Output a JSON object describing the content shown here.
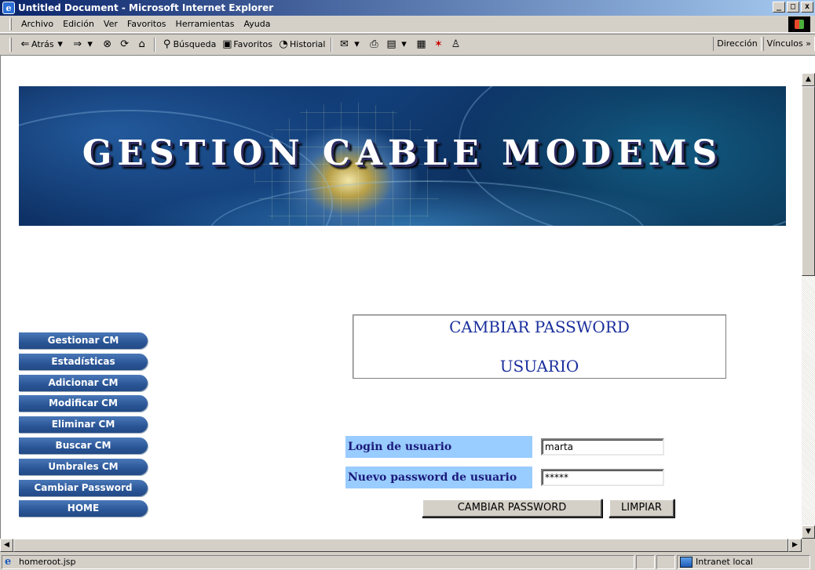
{
  "window": {
    "title": "Untitled Document - Microsoft Internet Explorer",
    "controls": {
      "minimize": "_",
      "maximize": "□",
      "close": "x"
    }
  },
  "menubar": {
    "items": [
      "Archivo",
      "Edición",
      "Ver",
      "Favoritos",
      "Herramientas",
      "Ayuda"
    ]
  },
  "toolbar": {
    "back": "Atrás",
    "search": "Búsqueda",
    "favorites": "Favoritos",
    "history": "Historial",
    "address": "Dirección",
    "links": "Vínculos »"
  },
  "banner": {
    "title": "GESTION CABLE MODEMS"
  },
  "nav": {
    "items": [
      "Gestionar CM",
      "Estadísticas",
      "Adicionar CM",
      "Modificar CM",
      "Eliminar CM",
      "Buscar CM",
      "Umbrales CM",
      "Cambiar Password",
      "HOME"
    ]
  },
  "page_title": {
    "line1": "CAMBIAR PASSWORD",
    "line2": "USUARIO"
  },
  "form": {
    "login_label": "Login de usuario",
    "login_value": "marta",
    "password_label": "Nuevo password de usuario",
    "password_value": "*****",
    "submit_label": "CAMBIAR PASSWORD",
    "reset_label": "LIMPIAR"
  },
  "status": {
    "url": "homeroot.jsp",
    "zone": "Intranet local"
  },
  "colors": {
    "nav_bg": "#2a5596",
    "label_bg": "#99ccff",
    "title_text": "#1a2f9c",
    "titlebar": "#0a246a"
  }
}
